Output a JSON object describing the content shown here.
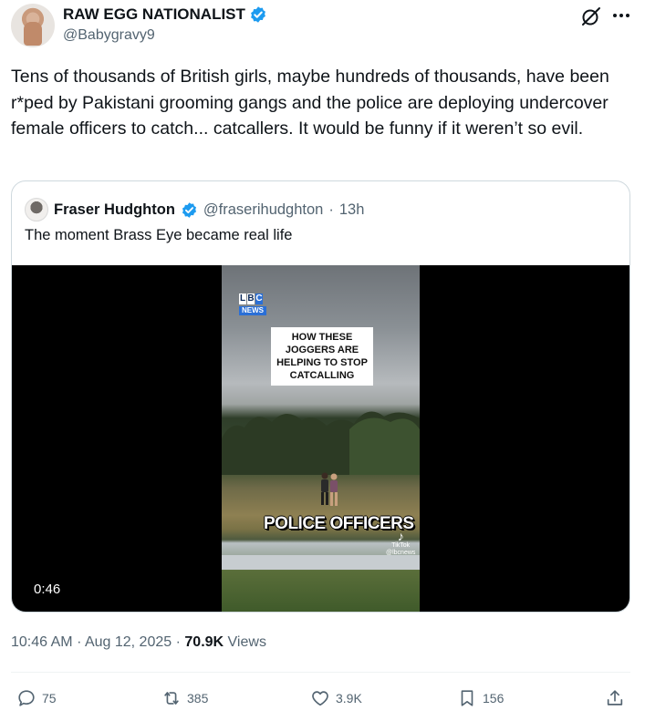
{
  "author": {
    "display_name": "RAW EGG NATIONALIST",
    "handle": "@Babygravy9",
    "verified": true
  },
  "tweet": {
    "text": "Tens of thousands of British girls, maybe hundreds of thousands, have been r*ped by Pakistani grooming gangs and the police are deploying undercover female officers to catch... catcallers. It would be funny if it weren’t so evil."
  },
  "quoted": {
    "display_name": "Fraser Hudghton",
    "handle": "@fraserihudghton",
    "separator": "·",
    "time": "13h",
    "text": "The moment Brass Eye became real life",
    "video": {
      "duration": "0:46",
      "logo_letters": [
        "L",
        "B",
        "C"
      ],
      "logo_sub": "NEWS",
      "caption": "HOW THESE JOGGERS ARE HELPING TO STOP CATCALLING",
      "overlay_text": "POLICE OFFICERS",
      "watermark_brand": "TikTok",
      "watermark_handle": "@lbcnews"
    }
  },
  "meta": {
    "time": "10:46 AM",
    "sep1": "·",
    "date": "Aug 12, 2025",
    "sep2": "·",
    "views_count": "70.9K",
    "views_label": "Views"
  },
  "actions": {
    "replies": "75",
    "reposts": "385",
    "likes": "3.9K",
    "bookmarks": "156"
  },
  "colors": {
    "verified_blue": "#1d9bf0",
    "secondary_text": "#536471",
    "primary_text": "#0f1419",
    "border": "#cfd9de"
  },
  "icons": {
    "verified": "verified-badge-icon",
    "grok": "grok-icon",
    "more": "more-icon",
    "reply": "reply-icon",
    "repost": "repost-icon",
    "like": "heart-icon",
    "bookmark": "bookmark-icon",
    "share": "share-icon"
  }
}
